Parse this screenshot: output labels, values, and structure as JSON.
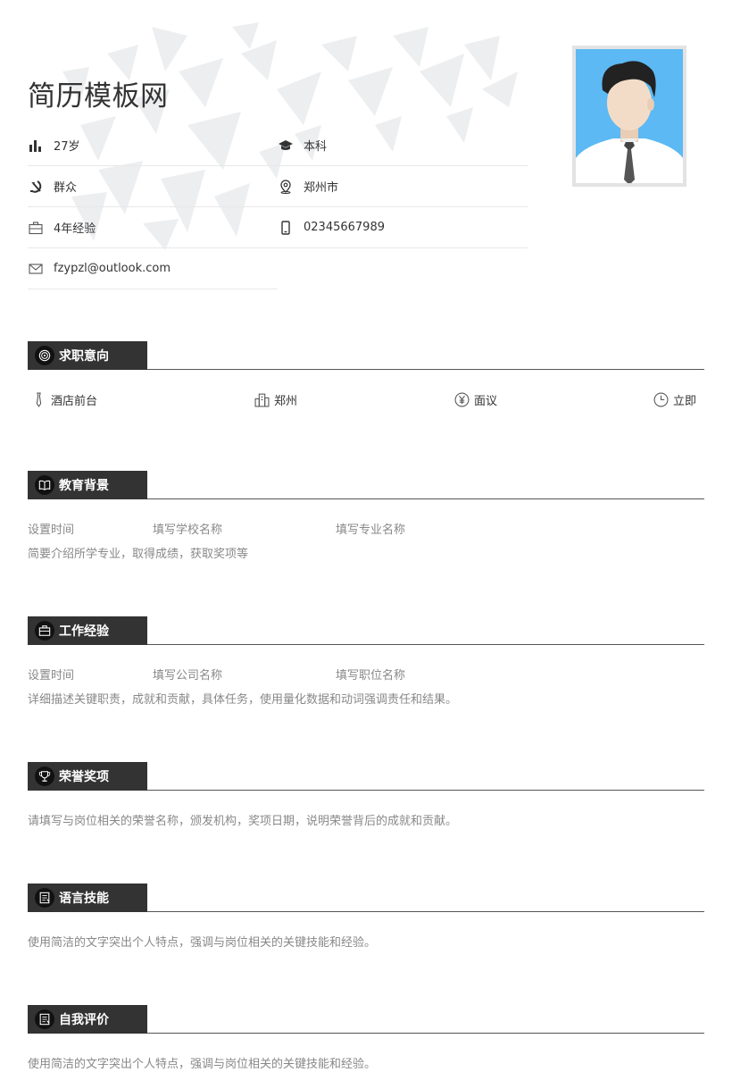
{
  "header": {
    "name": "简历模板网"
  },
  "info": {
    "age": "27岁",
    "education": "本科",
    "political": "群众",
    "location": "郑州市",
    "experience": "4年经验",
    "phone": "02345667989",
    "email": "fzypzl@outlook.com"
  },
  "sections": {
    "intent": {
      "title": "求职意向",
      "position": "酒店前台",
      "city": "郑州",
      "salary": "面议",
      "start": "立即"
    },
    "education": {
      "title": "教育背景",
      "time": "设置时间",
      "school": "填写学校名称",
      "major": "填写专业名称",
      "desc": "简要介绍所学专业，取得成绩，获取奖项等"
    },
    "work": {
      "title": "工作经验",
      "time": "设置时间",
      "company": "填写公司名称",
      "role": "填写职位名称",
      "desc": "详细描述关键职责，成就和贡献，具体任务，使用量化数据和动词强调责任和结果。"
    },
    "honors": {
      "title": "荣誉奖项",
      "desc": "请填写与岗位相关的荣誉名称，颁发机构，奖项日期，说明荣誉背后的成就和贡献。"
    },
    "language": {
      "title": "语言技能",
      "desc": "使用简洁的文字突出个人特点，强调与岗位相关的关键技能和经验。"
    },
    "self": {
      "title": "自我评价",
      "desc": "使用简洁的文字突出个人特点，强调与岗位相关的关键技能和经验。"
    }
  },
  "colors": {
    "header_bar": "#333333",
    "photo_bg": "#5cb9f4",
    "muted_text": "#888888"
  }
}
